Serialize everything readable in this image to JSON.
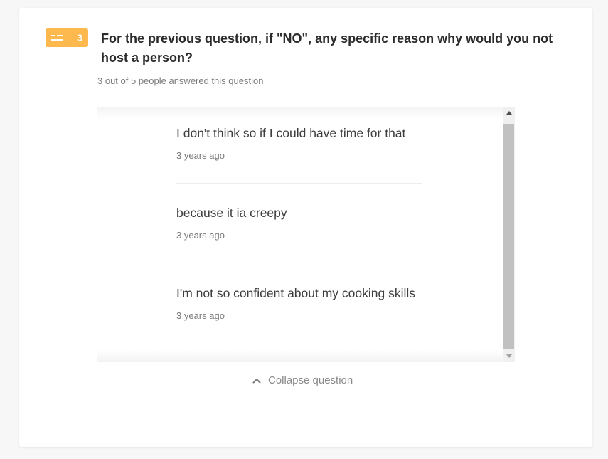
{
  "question": {
    "number": "3",
    "type_icon": "text-lines-icon",
    "badge_color": "#fdb94d",
    "title": "For the previous question, if \"NO\", any specific reason why would you not host a person?",
    "meta": "3 out of 5 people answered this question"
  },
  "answers": [
    {
      "text": "I don't think so if I could have time for that",
      "time": "3 years ago"
    },
    {
      "text": "because it ia creepy",
      "time": "3 years ago"
    },
    {
      "text": "I'm not so confident about my cooking skills",
      "time": "3 years ago"
    }
  ],
  "collapse": {
    "label": "Collapse question",
    "icon": "chevron-up-icon"
  }
}
